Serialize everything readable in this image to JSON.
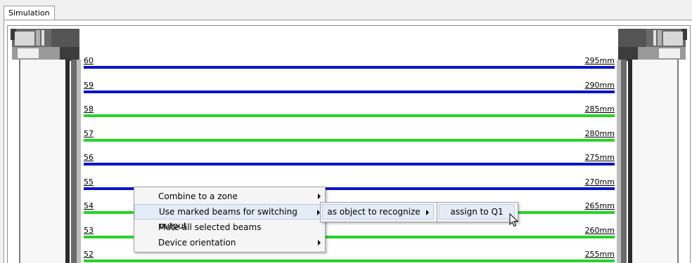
{
  "tab": {
    "label": "Simulation"
  },
  "colors": {
    "marked": "#0a14c8",
    "unmarked": "#28d228"
  },
  "beams": [
    {
      "num": "60",
      "mm": "295mm",
      "marked": true
    },
    {
      "num": "59",
      "mm": "290mm",
      "marked": true
    },
    {
      "num": "58",
      "mm": "285mm",
      "marked": false
    },
    {
      "num": "57",
      "mm": "280mm",
      "marked": false
    },
    {
      "num": "56",
      "mm": "275mm",
      "marked": true
    },
    {
      "num": "55",
      "mm": "270mm",
      "marked": true
    },
    {
      "num": "54",
      "mm": "265mm",
      "marked": false
    },
    {
      "num": "53",
      "mm": "260mm",
      "marked": false
    },
    {
      "num": "52",
      "mm": "255mm",
      "marked": false
    }
  ],
  "context_menu": {
    "items": [
      {
        "label": "Combine to a zone",
        "submenu": true
      },
      {
        "label": "Use marked beams for switching output",
        "submenu": true
      },
      {
        "label": "Mute all selected beams",
        "submenu": false
      },
      {
        "label": "Device orientation",
        "submenu": true
      }
    ],
    "submenu": {
      "label": "as object to recognize",
      "submenu": true
    },
    "submenu2": {
      "label": "assign to Q1"
    }
  }
}
